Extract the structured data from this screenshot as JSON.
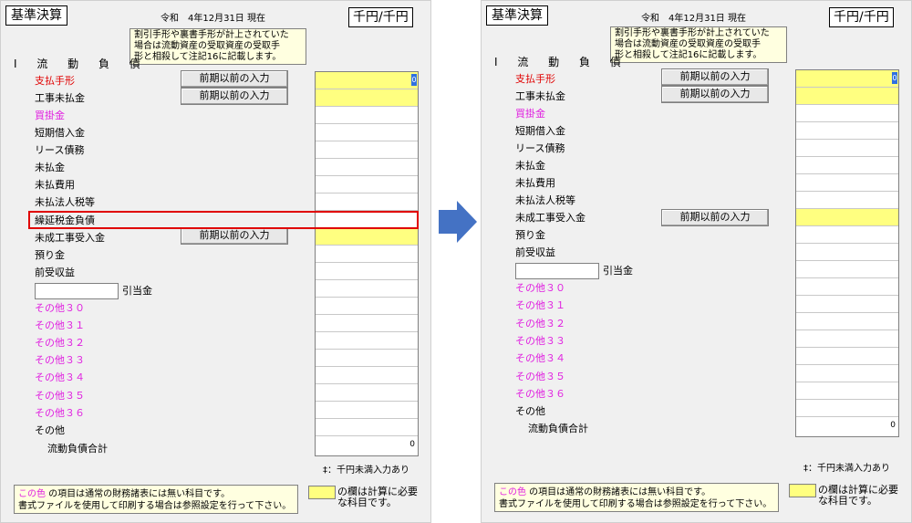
{
  "colors": {
    "accent_yellow": "#ffff80",
    "pink": "#e020e0",
    "red": "#e00000",
    "arrow": "#4472c4"
  },
  "common": {
    "title": "基準決算",
    "date": "令和　4年12月31日 現在",
    "unit": "千円/千円",
    "note": "割引手形や裏書手形が計上されていた\n場合は流動資産の受取資産の受取手\n形と相殺して注記16に記載します。",
    "section": "I 流 動 負 債",
    "btn_label": "前期以前の入力",
    "hikiate": "引当金",
    "thousand_note": "‡：千円未満入力あり",
    "footer_color_word": "この色",
    "footer_line1": " の項目は通常の財務諸表には無い科目です。",
    "footer_line2": "書式ファイルを使用して印刷する場合は参照設定を行って下さい。",
    "legend_text": "の欄は計算に必要\nな科目です。",
    "first_value": "0",
    "total_value": "0"
  },
  "left": {
    "items": [
      "支払手形",
      "工事未払金",
      "買掛金",
      "短期借入金",
      "リース債務",
      "未払金",
      "未払費用",
      "未払法人税等",
      "繰延税金負債",
      "未成工事受入金",
      "預り金",
      "前受収益"
    ],
    "others": [
      "その他３０",
      "その他３１",
      "その他３２",
      "その他３３",
      "その他３４",
      "その他３５",
      "その他３６",
      "その他"
    ],
    "total": "流動負債合計"
  },
  "right": {
    "items": [
      "支払手形",
      "工事未払金",
      "買掛金",
      "短期借入金",
      "リース債務",
      "未払金",
      "未払費用",
      "未払法人税等",
      "未成工事受入金",
      "預り金",
      "前受収益"
    ],
    "others": [
      "その他３０",
      "その他３１",
      "その他３２",
      "その他３３",
      "その他３４",
      "その他３５",
      "その他３６",
      "その他"
    ],
    "total": "流動負債合計"
  }
}
